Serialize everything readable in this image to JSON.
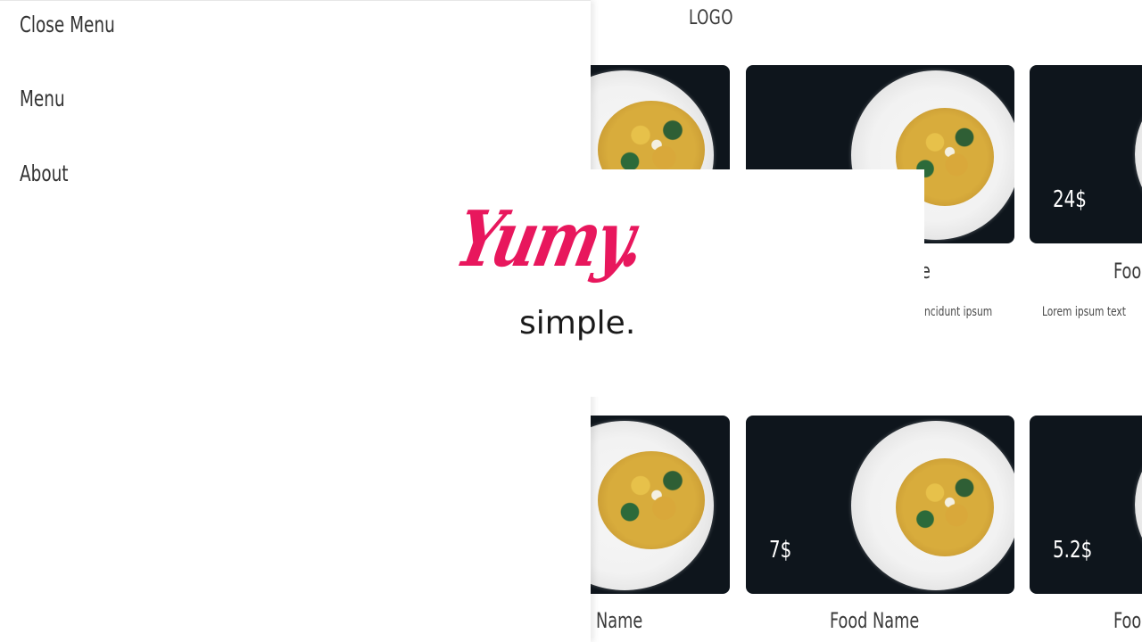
{
  "header": {
    "logo": "LOGO"
  },
  "menu": {
    "close_label": "Close Menu",
    "items": [
      {
        "label": "Menu"
      },
      {
        "label": "About"
      }
    ]
  },
  "splash": {
    "brand": "Yumy.",
    "tagline": "simple."
  },
  "cards": {
    "row1": [
      {
        "price": "",
        "name": "e",
        "desc": "ncidunt ipsum"
      },
      {
        "price": "24$",
        "name": "Foo",
        "desc": "Lorem ipsum text"
      }
    ],
    "row2": [
      {
        "name": "Name"
      },
      {
        "price": "7$",
        "name": "Food Name"
      },
      {
        "price": "5.2$",
        "name": "Foo"
      }
    ]
  }
}
